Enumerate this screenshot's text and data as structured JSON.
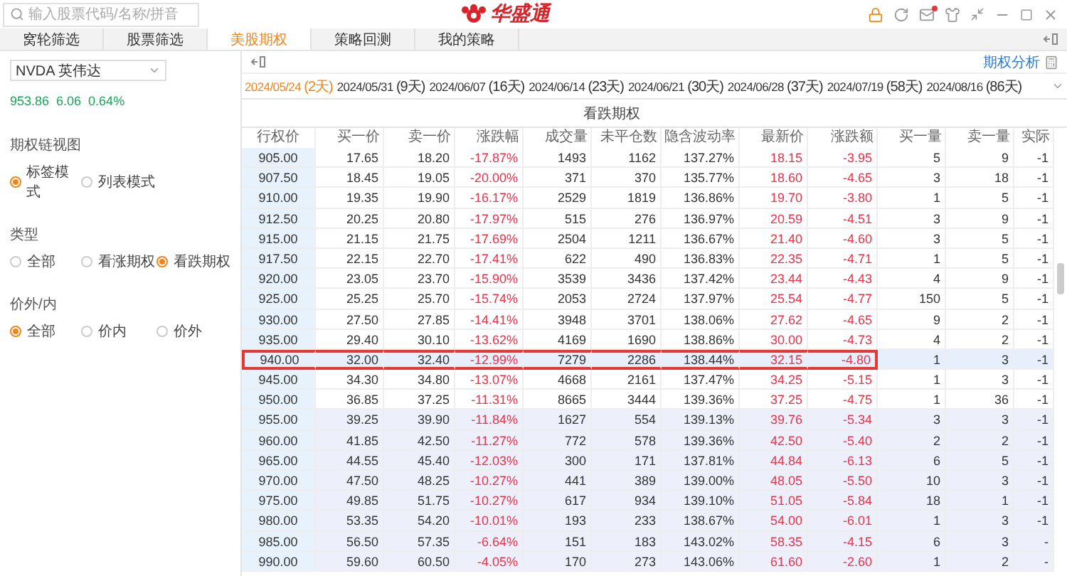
{
  "top_bar": {
    "search": {
      "placeholder": "输入股票代码/名称/拼音"
    },
    "logo_text": "华盛通"
  },
  "tabs": [
    {
      "label": "窝轮筛选",
      "selected": false
    },
    {
      "label": "股票筛选",
      "selected": false
    },
    {
      "label": "美股期权",
      "selected": true
    },
    {
      "label": "策略回测",
      "selected": false
    },
    {
      "label": "我的策略",
      "selected": false
    }
  ],
  "sidebar": {
    "stock": "NVDA 英伟达",
    "quote": "953.86  6.06  0.64%",
    "groups": [
      {
        "title": "期权链视图",
        "options": [
          {
            "label": "标签模式",
            "selected": true
          },
          {
            "label": "列表模式",
            "selected": false
          }
        ]
      },
      {
        "title": "类型",
        "options": [
          {
            "label": "全部",
            "selected": false
          },
          {
            "label": "看涨期权",
            "selected": false
          },
          {
            "label": "看跌期权",
            "selected": true
          }
        ]
      },
      {
        "title": "价外/内",
        "options": [
          {
            "label": "全部",
            "selected": true
          },
          {
            "label": "价内",
            "selected": false
          },
          {
            "label": "价外",
            "selected": false
          }
        ]
      }
    ]
  },
  "analysis_link": "期权分析",
  "expiries": [
    {
      "date": "2024/05/24",
      "days": "(2天)",
      "selected": true
    },
    {
      "date": "2024/05/31",
      "days": "(9天)",
      "selected": false
    },
    {
      "date": "2024/06/07",
      "days": "(16天)",
      "selected": false
    },
    {
      "date": "2024/06/14",
      "days": "(23天)",
      "selected": false
    },
    {
      "date": "2024/06/21",
      "days": "(30天)",
      "selected": false
    },
    {
      "date": "2024/06/28",
      "days": "(37天)",
      "selected": false
    },
    {
      "date": "2024/07/19",
      "days": "(58天)",
      "selected": false
    },
    {
      "date": "2024/08/16",
      "days": "(86天)",
      "selected": false
    }
  ],
  "table": {
    "group_title": "看跌期权",
    "columns": [
      {
        "label": "行权价",
        "kind": "strike"
      },
      {
        "label": "买一价",
        "kind": "num"
      },
      {
        "label": "卖一价",
        "kind": "num"
      },
      {
        "label": "涨跌幅",
        "kind": "loss"
      },
      {
        "label": "成交量",
        "kind": "num"
      },
      {
        "label": "未平仓数",
        "kind": "num"
      },
      {
        "label": "隐含波动率",
        "kind": "num"
      },
      {
        "label": "最新价",
        "kind": "loss"
      },
      {
        "label": "涨跌额",
        "kind": "loss"
      },
      {
        "label": "买一量",
        "kind": "num"
      },
      {
        "label": "卖一量",
        "kind": "num"
      },
      {
        "label": "实际",
        "kind": "num"
      }
    ],
    "rows": [
      {
        "itm": false,
        "selected": false,
        "cells": [
          "905.00",
          "17.65",
          "18.20",
          "-17.87%",
          "1493",
          "1162",
          "137.27%",
          "18.15",
          "-3.95",
          "5",
          "9",
          "-1"
        ]
      },
      {
        "itm": false,
        "selected": false,
        "cells": [
          "907.50",
          "18.45",
          "19.05",
          "-20.00%",
          "371",
          "370",
          "135.77%",
          "18.60",
          "-4.65",
          "3",
          "18",
          "-1"
        ]
      },
      {
        "itm": false,
        "selected": false,
        "cells": [
          "910.00",
          "19.35",
          "19.90",
          "-16.17%",
          "2529",
          "1819",
          "136.86%",
          "19.70",
          "-3.80",
          "1",
          "5",
          "-1"
        ]
      },
      {
        "itm": false,
        "selected": false,
        "cells": [
          "912.50",
          "20.25",
          "20.80",
          "-17.97%",
          "515",
          "276",
          "136.97%",
          "20.59",
          "-4.51",
          "3",
          "9",
          "-1"
        ]
      },
      {
        "itm": false,
        "selected": false,
        "cells": [
          "915.00",
          "21.15",
          "21.75",
          "-17.69%",
          "2504",
          "1211",
          "136.67%",
          "21.40",
          "-4.60",
          "3",
          "5",
          "-1"
        ]
      },
      {
        "itm": false,
        "selected": false,
        "cells": [
          "917.50",
          "22.15",
          "22.70",
          "-17.41%",
          "622",
          "490",
          "136.83%",
          "22.35",
          "-4.71",
          "1",
          "5",
          "-1"
        ]
      },
      {
        "itm": false,
        "selected": false,
        "cells": [
          "920.00",
          "23.05",
          "23.70",
          "-15.90%",
          "3539",
          "3436",
          "137.42%",
          "23.44",
          "-4.43",
          "4",
          "9",
          "-1"
        ]
      },
      {
        "itm": false,
        "selected": false,
        "cells": [
          "925.00",
          "25.25",
          "25.70",
          "-15.74%",
          "2053",
          "2724",
          "137.97%",
          "25.54",
          "-4.77",
          "150",
          "5",
          "-1"
        ]
      },
      {
        "itm": false,
        "selected": false,
        "cells": [
          "930.00",
          "27.50",
          "27.85",
          "-14.41%",
          "3948",
          "3701",
          "138.06%",
          "27.62",
          "-4.65",
          "9",
          "2",
          "-1"
        ]
      },
      {
        "itm": false,
        "selected": false,
        "cells": [
          "935.00",
          "29.40",
          "30.10",
          "-13.62%",
          "4169",
          "1690",
          "138.86%",
          "30.00",
          "-4.73",
          "4",
          "2",
          "-1"
        ]
      },
      {
        "itm": false,
        "selected": true,
        "cells": [
          "940.00",
          "32.00",
          "32.40",
          "-12.99%",
          "7279",
          "2286",
          "138.44%",
          "32.15",
          "-4.80",
          "1",
          "3",
          "-1"
        ]
      },
      {
        "itm": false,
        "selected": false,
        "cells": [
          "945.00",
          "34.30",
          "34.80",
          "-13.07%",
          "4668",
          "2161",
          "137.47%",
          "34.25",
          "-5.15",
          "1",
          "3",
          "-1"
        ]
      },
      {
        "itm": false,
        "selected": false,
        "cells": [
          "950.00",
          "36.85",
          "37.25",
          "-11.31%",
          "8665",
          "3444",
          "139.36%",
          "37.25",
          "-4.75",
          "1",
          "36",
          "-1"
        ]
      },
      {
        "itm": true,
        "selected": false,
        "cells": [
          "955.00",
          "39.25",
          "39.90",
          "-11.84%",
          "1627",
          "554",
          "139.13%",
          "39.76",
          "-5.34",
          "3",
          "3",
          "-1"
        ]
      },
      {
        "itm": true,
        "selected": false,
        "cells": [
          "960.00",
          "41.85",
          "42.50",
          "-11.27%",
          "772",
          "578",
          "139.36%",
          "42.50",
          "-5.40",
          "2",
          "2",
          "-1"
        ]
      },
      {
        "itm": true,
        "selected": false,
        "cells": [
          "965.00",
          "44.55",
          "45.40",
          "-12.03%",
          "300",
          "171",
          "137.81%",
          "44.84",
          "-6.13",
          "6",
          "5",
          "-1"
        ]
      },
      {
        "itm": true,
        "selected": false,
        "cells": [
          "970.00",
          "47.50",
          "48.25",
          "-10.27%",
          "441",
          "389",
          "139.00%",
          "48.05",
          "-5.50",
          "10",
          "3",
          "-1"
        ]
      },
      {
        "itm": true,
        "selected": false,
        "cells": [
          "975.00",
          "49.85",
          "51.75",
          "-10.27%",
          "617",
          "934",
          "139.10%",
          "51.05",
          "-5.84",
          "18",
          "1",
          "-1"
        ]
      },
      {
        "itm": true,
        "selected": false,
        "cells": [
          "980.00",
          "53.35",
          "54.20",
          "-10.01%",
          "193",
          "233",
          "138.67%",
          "54.00",
          "-6.01",
          "1",
          "3",
          "-1"
        ]
      },
      {
        "itm": true,
        "selected": false,
        "cells": [
          "985.00",
          "56.50",
          "57.35",
          "-6.64%",
          "151",
          "183",
          "143.02%",
          "58.35",
          "-4.15",
          "6",
          "3",
          "-"
        ]
      },
      {
        "itm": true,
        "selected": false,
        "cells": [
          "990.00",
          "59.60",
          "60.50",
          "-4.05%",
          "170",
          "273",
          "143.06%",
          "61.60",
          "-2.60",
          "1",
          "2",
          "-"
        ]
      }
    ]
  }
}
